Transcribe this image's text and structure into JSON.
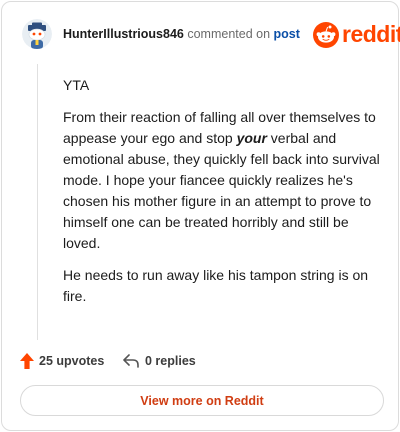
{
  "comment": {
    "author": "HunterIllustrious846",
    "action_text": "commented on",
    "post_link_text": "post",
    "body": {
      "opener": "YTA",
      "p1_before": "From their reaction of falling all over themselves to appease your ego and stop ",
      "p1_emphasis": "your",
      "p1_after": " verbal and emotional abuse, they quickly fell back into survival mode. I hope your fiancee quickly realizes he's chosen his mother figure in an attempt to prove to himself one can be treated horribly and still be loved.",
      "p2": "He needs to run away like his tampon string is on fire."
    }
  },
  "brand": {
    "wordmark": "reddit",
    "color": "#ff4500"
  },
  "stats": {
    "upvotes": "25 upvotes",
    "replies": "0 replies"
  },
  "actions": {
    "view_more": "View more on Reddit"
  },
  "icons": {
    "avatar": "snoo-avatar-icon",
    "logo": "reddit-snoo-icon",
    "upvote": "upvote-arrow-icon",
    "reply": "reply-arrow-icon"
  }
}
